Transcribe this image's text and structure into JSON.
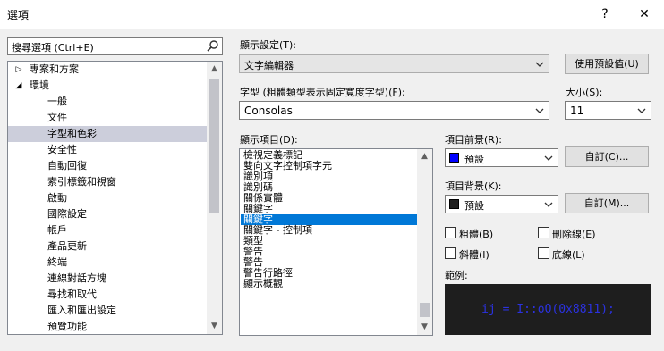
{
  "window": {
    "title": "選項",
    "help_label": "?",
    "close_label": "✕"
  },
  "search": {
    "value": "搜尋選項 (Ctrl+E)"
  },
  "tree": {
    "items": [
      {
        "label": "專案和方案",
        "indent": 0,
        "expander": "▷",
        "selected": false
      },
      {
        "label": "環境",
        "indent": 0,
        "expander": "◢",
        "selected": false
      },
      {
        "label": "一般",
        "indent": 1,
        "selected": false
      },
      {
        "label": "文件",
        "indent": 1,
        "selected": false
      },
      {
        "label": "字型和色彩",
        "indent": 1,
        "selected": true
      },
      {
        "label": "安全性",
        "indent": 1,
        "selected": false
      },
      {
        "label": "自動回復",
        "indent": 1,
        "selected": false
      },
      {
        "label": "索引標籤和視窗",
        "indent": 1,
        "selected": false
      },
      {
        "label": "啟動",
        "indent": 1,
        "selected": false
      },
      {
        "label": "國際設定",
        "indent": 1,
        "selected": false
      },
      {
        "label": "帳戶",
        "indent": 1,
        "selected": false
      },
      {
        "label": "產品更新",
        "indent": 1,
        "selected": false
      },
      {
        "label": "終端",
        "indent": 1,
        "selected": false
      },
      {
        "label": "連線對話方塊",
        "indent": 1,
        "selected": false
      },
      {
        "label": "尋找和取代",
        "indent": 1,
        "selected": false
      },
      {
        "label": "匯入和匯出設定",
        "indent": 1,
        "selected": false
      },
      {
        "label": "預覽功能",
        "indent": 1,
        "selected": false
      }
    ],
    "scroll_up": "▲",
    "scroll_down": "▼"
  },
  "display_settings": {
    "label": "顯示設定(T):",
    "value": "文字編輯器",
    "defaults_button": "使用預設值(U)"
  },
  "font": {
    "label": "字型 (粗體類型表示固定寬度字型)(F):",
    "value": "Consolas"
  },
  "size": {
    "label": "大小(S):",
    "value": "11"
  },
  "display_items": {
    "label": "顯示項目(D):",
    "items": [
      {
        "label": "檢視定義標記",
        "selected": false
      },
      {
        "label": "雙向文字控制項字元",
        "selected": false
      },
      {
        "label": "識別項",
        "selected": false
      },
      {
        "label": "識別碼",
        "selected": false
      },
      {
        "label": "關係實體",
        "selected": false
      },
      {
        "label": "關鍵字",
        "selected": false
      },
      {
        "label": "關鍵字",
        "selected": true
      },
      {
        "label": "關鍵字 - 控制項",
        "selected": false
      },
      {
        "label": "類型",
        "selected": false
      },
      {
        "label": "警告",
        "selected": false
      },
      {
        "label": "警告",
        "selected": false
      },
      {
        "label": "警告行路徑",
        "selected": false
      },
      {
        "label": "顯示概觀",
        "selected": false
      }
    ]
  },
  "foreground": {
    "label": "項目前景(R):",
    "value": "預設",
    "swatch_color": "#0000ff",
    "custom_button": "自訂(C)..."
  },
  "background": {
    "label": "項目背景(K):",
    "value": "預設",
    "swatch_color": "#1e1e1e",
    "custom_button": "自訂(M)..."
  },
  "styles": {
    "bold": "粗體(B)",
    "strikethrough": "刪除線(E)",
    "italic": "斜體(I)",
    "underline": "底線(L)"
  },
  "sample": {
    "label": "範例:",
    "code": "ij = I::oO(0x8811);",
    "text_color": "#2b32e0",
    "bg_color": "#1e1e1e"
  }
}
